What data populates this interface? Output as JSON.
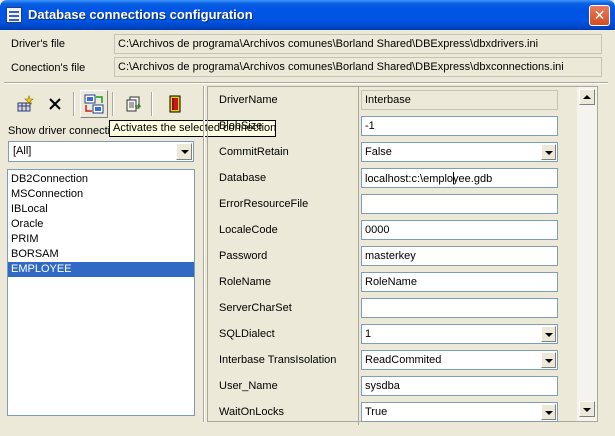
{
  "window": {
    "title": "Database connections configuration",
    "close": "✕"
  },
  "files": {
    "driver_label": "Driver's file",
    "driver_value": "C:\\Archivos de programa\\Archivos comunes\\Borland Shared\\DBExpress\\dbxdrivers.ini",
    "connection_label": "Conection's file",
    "connection_value": "C:\\Archivos de programa\\Archivos comunes\\Borland Shared\\DBExpress\\dbxconnections.ini"
  },
  "toolbar": {
    "buttons": [
      "add-connection-icon",
      "delete-connection-icon",
      "activate-connection-icon",
      "copy-connection-icon",
      "exit-icon"
    ],
    "tooltip": "Activates the selected connection"
  },
  "filter": {
    "label": "Show driver connecti",
    "selected": "[All]"
  },
  "connections": [
    "DB2Connection",
    "MSConnection",
    "IBLocal",
    "Oracle",
    "PRIM",
    "BORSAM",
    "EMPLOYEE"
  ],
  "selected_connection": "EMPLOYEE",
  "properties": [
    {
      "name": "DriverName",
      "value": "Interbase",
      "kind": "readonly"
    },
    {
      "name": "BlobSize",
      "value": "-1",
      "kind": "text"
    },
    {
      "name": "CommitRetain",
      "value": "False",
      "kind": "combo"
    },
    {
      "name": "Database",
      "value_before_caret": "localhost:c:\\emplo",
      "value_after_caret": "yee.gdb",
      "kind": "text"
    },
    {
      "name": "ErrorResourceFile",
      "value": "",
      "kind": "text"
    },
    {
      "name": "LocaleCode",
      "value": "0000",
      "kind": "text"
    },
    {
      "name": "Password",
      "value": "masterkey",
      "kind": "text"
    },
    {
      "name": "RoleName",
      "value": "RoleName",
      "kind": "text"
    },
    {
      "name": "ServerCharSet",
      "value": "",
      "kind": "text"
    },
    {
      "name": "SQLDialect",
      "value": "1",
      "kind": "combo"
    },
    {
      "name": "Interbase TransIsolation",
      "value": "ReadCommited",
      "kind": "combo"
    },
    {
      "name": "User_Name",
      "value": "sysdba",
      "kind": "text"
    },
    {
      "name": "WaitOnLocks",
      "value": "True",
      "kind": "combo"
    }
  ]
}
